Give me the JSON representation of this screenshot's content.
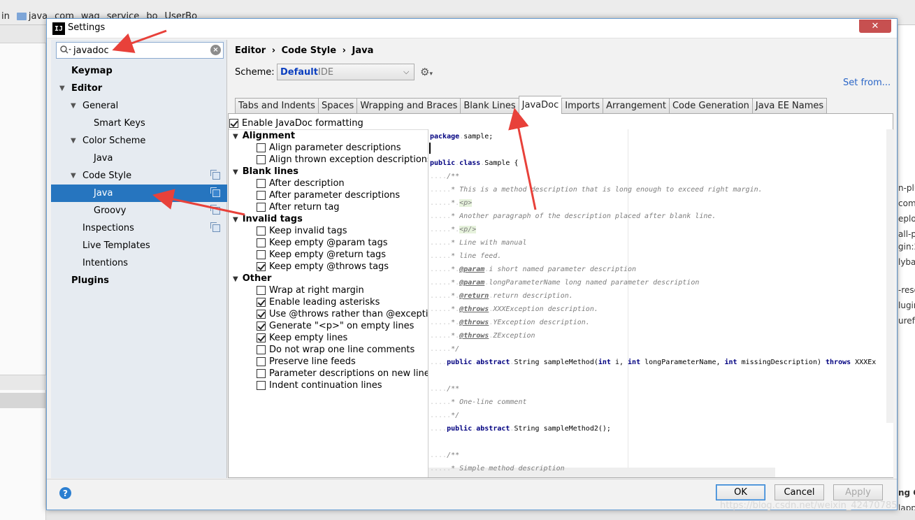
{
  "background": {
    "crumbs": [
      "in",
      "java",
      "com",
      "waq",
      "service",
      "bo",
      "UserBo"
    ],
    "right_fragments": [
      "n-plu",
      "comp",
      "eploy",
      "all-p",
      "gin:2",
      "lybat",
      "-reso",
      "lugin",
      "urefir",
      "ng C",
      "lapp"
    ]
  },
  "watermark": "https://blog.csdn.net/weixin_42470785",
  "dialog": {
    "app_icon": "IJ",
    "title": "Settings",
    "close_glyph": "✕"
  },
  "search": {
    "value": "javadoc",
    "clear_glyph": "×"
  },
  "nav": {
    "items": [
      {
        "label": "Keymap"
      },
      {
        "label": "Editor"
      },
      {
        "label": "General"
      },
      {
        "label": "Smart Keys"
      },
      {
        "label": "Color Scheme"
      },
      {
        "label": "Java"
      },
      {
        "label": "Code Style"
      },
      {
        "label": "Java"
      },
      {
        "label": "Groovy"
      },
      {
        "label": "Inspections"
      },
      {
        "label": "Live Templates"
      },
      {
        "label": "Intentions"
      },
      {
        "label": "Plugins"
      }
    ]
  },
  "breadcrumb": [
    "Editor",
    "›",
    "Code Style",
    "›",
    "Java"
  ],
  "scheme": {
    "label": "Scheme:",
    "value": "Default",
    "suffix": "IDE"
  },
  "set_from": "Set from...",
  "tabs": [
    "Tabs and Indents",
    "Spaces",
    "Wrapping and Braces",
    "Blank Lines",
    "JavaDoc",
    "Imports",
    "Arrangement",
    "Code Generation",
    "Java EE Names"
  ],
  "enable_javadoc": "Enable JavaDoc formatting",
  "sections": {
    "alignment": {
      "title": "Alignment",
      "options": [
        "Align parameter descriptions",
        "Align thrown exception descriptions"
      ]
    },
    "blank_lines": {
      "title": "Blank lines",
      "options": [
        "After description",
        "After parameter descriptions",
        "After return tag"
      ]
    },
    "invalid_tags": {
      "title": "Invalid tags",
      "options": [
        "Keep invalid tags",
        "Keep empty @param tags",
        "Keep empty @return tags",
        "Keep empty @throws tags"
      ]
    },
    "other": {
      "title": "Other",
      "options": [
        "Wrap at right margin",
        "Enable leading asterisks",
        "Use @throws rather than @exception",
        "Generate \"<p>\" on empty lines",
        "Keep empty lines",
        "Do not wrap one line comments",
        "Preserve line feeds",
        "Parameter descriptions on new line",
        "Indent continuation lines"
      ]
    }
  },
  "code": {
    "l0_kw": "package",
    "l0_rest": "sample;",
    "l1_kw1": "public",
    "l1_kw2": "class",
    "l1_rest": "Sample {",
    "c_open": "/**",
    "c1": "* This is a method description that is long enough to exceed right margin.",
    "p_open": "<p>",
    "c3": "* Another paragraph of the description placed after blank line.",
    "p_close": "<p/>",
    "c5": "* Line with manual",
    "c6": "* line feed.",
    "tag_param": "@param",
    "c7": "i short named parameter description",
    "c8": "longParameterName long named parameter description",
    "tag_return": "@return",
    "c9": "return description.",
    "tag_throws": "@throws",
    "c10": "XXXException description.",
    "c11": "YException description.",
    "c12": "ZException",
    "c_close": "*/",
    "m1_a": "public",
    "m1_b": "abstract",
    "m1_c": "String sampleMethod(",
    "m1_d": "int",
    "m1_e": " i, ",
    "m1_f": "int",
    "m1_g": " longParameterName, ",
    "m1_h": "int",
    "m1_i": " missingDescription) ",
    "m1_j": "throws",
    "m1_k": " XXXEx",
    "c13": "* One-line comment",
    "m2_a": "public",
    "m2_b": "abstract",
    "m2_c": "String sampleMethod2();",
    "c14": "* Simple method description"
  },
  "footer": {
    "help": "?",
    "ok": "OK",
    "cancel": "Cancel",
    "apply": "Apply"
  },
  "colors": {
    "accent": "#2675bf",
    "link": "#2b66c7",
    "close": "#c75050",
    "annotation_arrow": "#e8413a"
  }
}
